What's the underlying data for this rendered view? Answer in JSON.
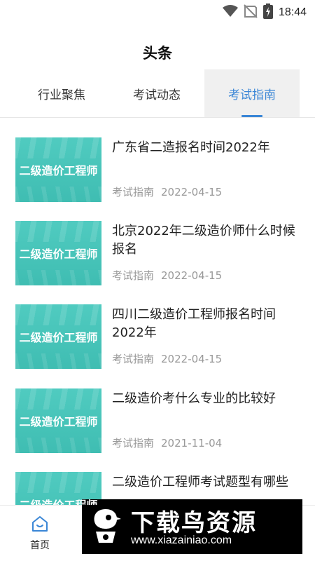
{
  "status_bar": {
    "time": "18:44",
    "icons": [
      "wifi-icon",
      "no-signal-icon",
      "battery-charging-icon"
    ]
  },
  "header": {
    "title": "头条"
  },
  "tabs": [
    {
      "label": "行业聚焦",
      "active": false
    },
    {
      "label": "考试动态",
      "active": false
    },
    {
      "label": "考试指南",
      "active": true
    }
  ],
  "colors": {
    "accent": "#3a86d6",
    "thumbnail": "#46c3b8",
    "meta_text": "#999999"
  },
  "news": [
    {
      "thumb_text": "二级造价工程师",
      "title": "广东省二造报名时间2022年",
      "category": "考试指南",
      "date": "2022-04-15"
    },
    {
      "thumb_text": "二级造价工程师",
      "title": "北京2022年二级造价师什么时候报名",
      "category": "考试指南",
      "date": "2022-04-15"
    },
    {
      "thumb_text": "二级造价工程师",
      "title": "四川二级造价工程师报名时间2022年",
      "category": "考试指南",
      "date": "2022-04-15"
    },
    {
      "thumb_text": "二级造价工程师",
      "title": "二级造价考什么专业的比较好",
      "category": "考试指南",
      "date": "2021-11-04"
    },
    {
      "thumb_text": "二级造价工程师",
      "title": "二级造价工程师考试题型有哪些",
      "category": "",
      "date": ""
    }
  ],
  "bottom_nav": {
    "items": [
      {
        "label": "首页",
        "icon": "home-icon"
      }
    ]
  },
  "watermark": {
    "title": "下载鸟资源",
    "url": "www.xiazainiao.com"
  }
}
